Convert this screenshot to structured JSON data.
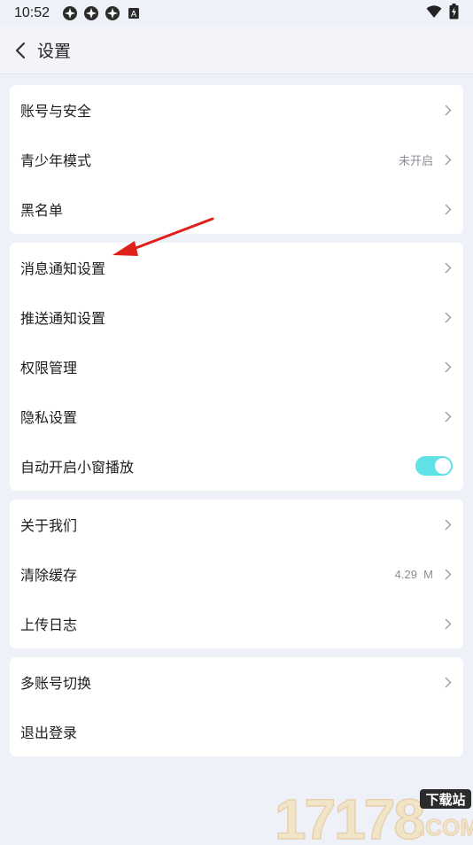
{
  "status_bar": {
    "time": "10:52",
    "left_icons": [
      "app-notification-icon",
      "app-notification-icon",
      "app-notification-icon",
      "a-badge-icon"
    ],
    "badge_letter": "A",
    "right_icons": [
      "wifi-icon",
      "battery-charging-icon"
    ]
  },
  "header": {
    "back_icon": "chevron-left-icon",
    "title": "设置"
  },
  "groups": [
    {
      "items": [
        {
          "label": "账号与安全",
          "value": "",
          "control": "chevron"
        },
        {
          "label": "青少年模式",
          "value": "未开启",
          "control": "chevron"
        },
        {
          "label": "黑名单",
          "value": "",
          "control": "chevron"
        }
      ]
    },
    {
      "items": [
        {
          "label": "消息通知设置",
          "value": "",
          "control": "chevron"
        },
        {
          "label": "推送通知设置",
          "value": "",
          "control": "chevron"
        },
        {
          "label": "权限管理",
          "value": "",
          "control": "chevron"
        },
        {
          "label": "隐私设置",
          "value": "",
          "control": "chevron"
        },
        {
          "label": "自动开启小窗播放",
          "value": "",
          "control": "toggle",
          "toggle_on": true
        }
      ]
    },
    {
      "items": [
        {
          "label": "关于我们",
          "value": "",
          "control": "chevron"
        },
        {
          "label": "清除缓存",
          "value": "4.29  M",
          "control": "chevron"
        },
        {
          "label": "上传日志",
          "value": "",
          "control": "chevron"
        }
      ]
    },
    {
      "items": [
        {
          "label": "多账号切换",
          "value": "",
          "control": "chevron"
        },
        {
          "label": "退出登录",
          "value": "",
          "control": "none"
        }
      ]
    }
  ],
  "colors": {
    "background": "#eff1f9",
    "card": "#ffffff",
    "toggle_on": "#5fe1e6",
    "annotation_arrow": "#e0201b",
    "value_text": "#8a8d95"
  },
  "watermark": {
    "number": "17178",
    "badge": "下载站",
    "suffix": ".COM"
  }
}
